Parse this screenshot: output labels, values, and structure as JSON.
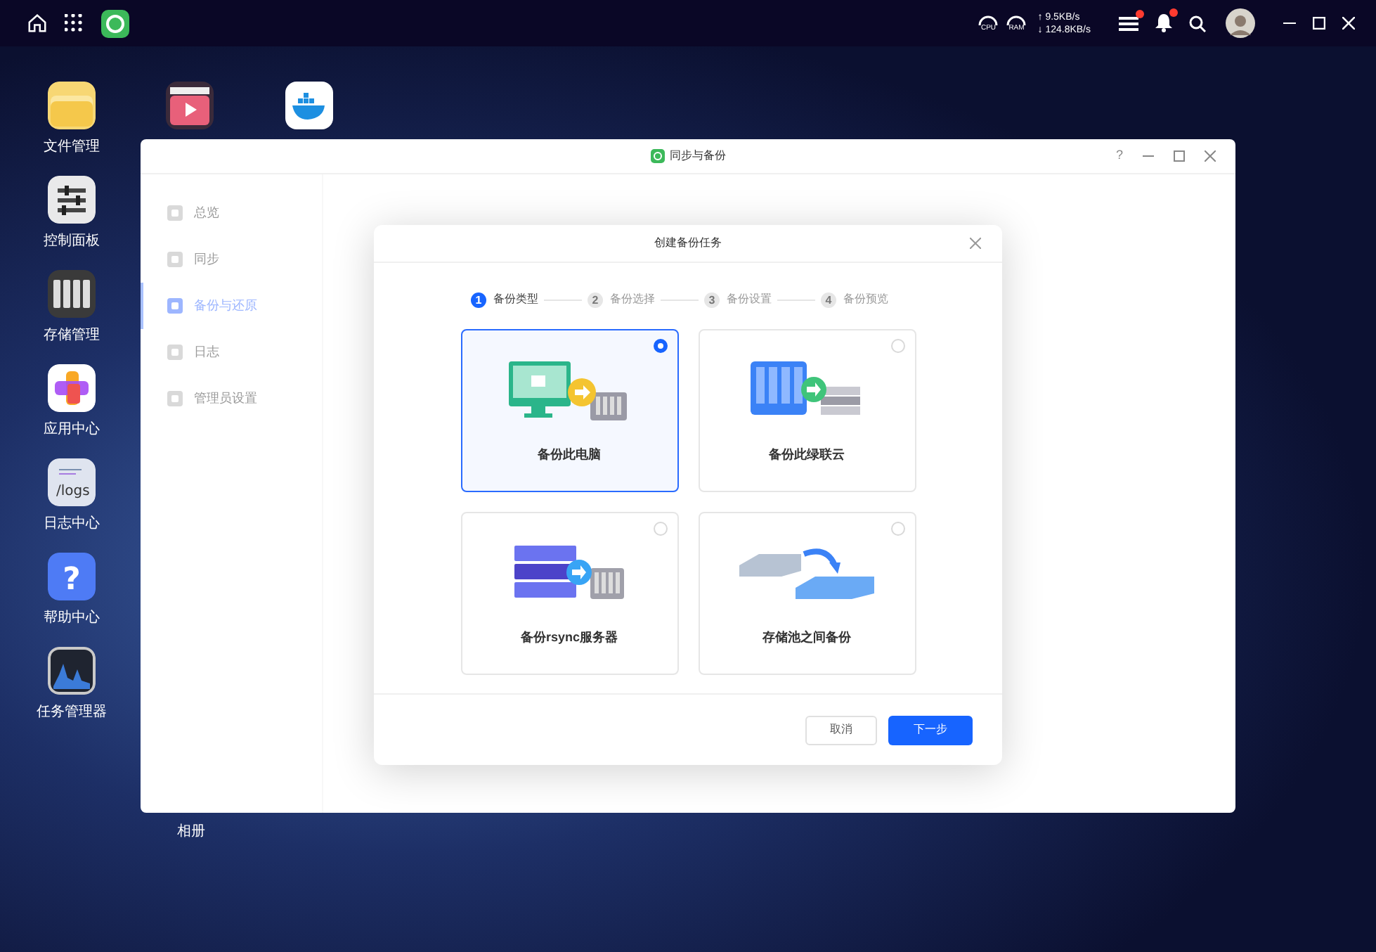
{
  "top_bar": {
    "gauges": [
      "CPU",
      "RAM"
    ],
    "net_up": "↑ 9.5KB/s",
    "net_down": "↓ 124.8KB/s",
    "transfers_badge": true,
    "notifications_badge": true
  },
  "desktop_icons": [
    {
      "label": "文件管理"
    },
    {
      "label": "控制面板"
    },
    {
      "label": "存储管理"
    },
    {
      "label": "应用中心"
    },
    {
      "label": "日志中心",
      "icon_text": "/logs"
    },
    {
      "label": "帮助中心",
      "icon_text": "?"
    },
    {
      "label": "任务管理器"
    }
  ],
  "desktop_second_column_label": "相册",
  "window": {
    "title": "同步与备份",
    "help": "?",
    "sidebar": [
      {
        "label": "总览",
        "selected": false
      },
      {
        "label": "同步",
        "selected": false
      },
      {
        "label": "备份与还原",
        "selected": true
      },
      {
        "label": "日志",
        "selected": false
      },
      {
        "label": "管理员设置",
        "selected": false
      }
    ]
  },
  "dialog": {
    "title": "创建备份任务",
    "steps": [
      {
        "number": "1",
        "label": "备份类型",
        "selected": true
      },
      {
        "number": "2",
        "label": "备份选择",
        "selected": false
      },
      {
        "number": "3",
        "label": "备份设置",
        "selected": false
      },
      {
        "number": "4",
        "label": "备份预览",
        "selected": false
      }
    ],
    "options": [
      {
        "label": "备份此电脑",
        "selected": true
      },
      {
        "label": "备份此绿联云",
        "selected": false
      },
      {
        "label": "备份rsync服务器",
        "selected": false
      },
      {
        "label": "存储池之间备份",
        "selected": false
      }
    ],
    "buttons": [
      {
        "label": "取消",
        "kind": "secondary"
      },
      {
        "label": "下一步",
        "kind": "primary"
      }
    ]
  }
}
